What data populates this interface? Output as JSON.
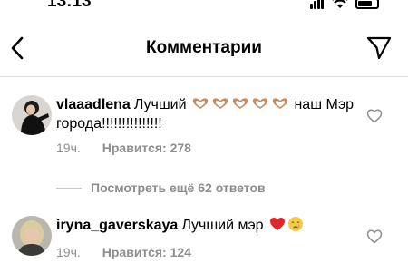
{
  "status_bar": {
    "time": "13:13"
  },
  "header": {
    "title": "Комментарии",
    "back_icon": "chevron-left-icon",
    "send_icon": "paper-plane-icon"
  },
  "comments": [
    {
      "username": "vlaaadlena",
      "text_before": "Лучший",
      "emojis": [
        "heart-hands",
        "heart-hands",
        "heart-hands",
        "heart-hands",
        "heart-hands"
      ],
      "text_after": "наш Мэр города!!!!!!!!!!!!!!!",
      "time": "19ч.",
      "likes": "Нравится: 278"
    },
    {
      "username": "iryna_gaverskaya",
      "text_before": "Лучший мэр",
      "emojis": [
        "red-heart",
        "crying-face"
      ],
      "text_after": "",
      "time": "19ч.",
      "likes": "Нравится: 124"
    }
  ],
  "view_replies": {
    "label": "Посмотреть ещё 62 ответов"
  },
  "colors": {
    "meta_gray": "#8e8e8e",
    "divider": "#dbdbdb",
    "heart_red": "#e0272b"
  }
}
